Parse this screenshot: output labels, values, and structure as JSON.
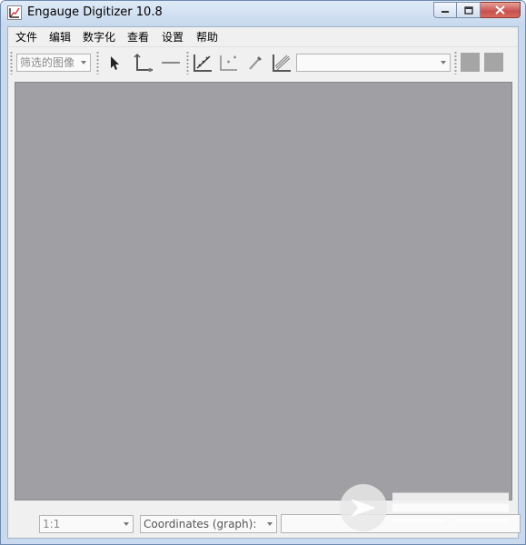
{
  "window": {
    "title": "Engauge Digitizer 10.8"
  },
  "menu": {
    "items": [
      "文件",
      "编辑",
      "数字化",
      "查看",
      "设置",
      "帮助"
    ]
  },
  "toolbar": {
    "filter_combo": "筛选的图像",
    "curve_combo": "",
    "icons": [
      "select-arrow-icon",
      "axis-point-icon",
      "scale-bar-icon",
      "curve-point-icon",
      "point-match-icon",
      "color-picker-icon",
      "segment-fill-icon"
    ]
  },
  "status": {
    "zoom": "1:1",
    "coordinates_label": "Coordinates (graph):",
    "coordinates_value": ""
  },
  "colors": {
    "canvas": "#a0a0a4",
    "titlebar": "#c6d8ee",
    "close_button": "#c75050"
  }
}
